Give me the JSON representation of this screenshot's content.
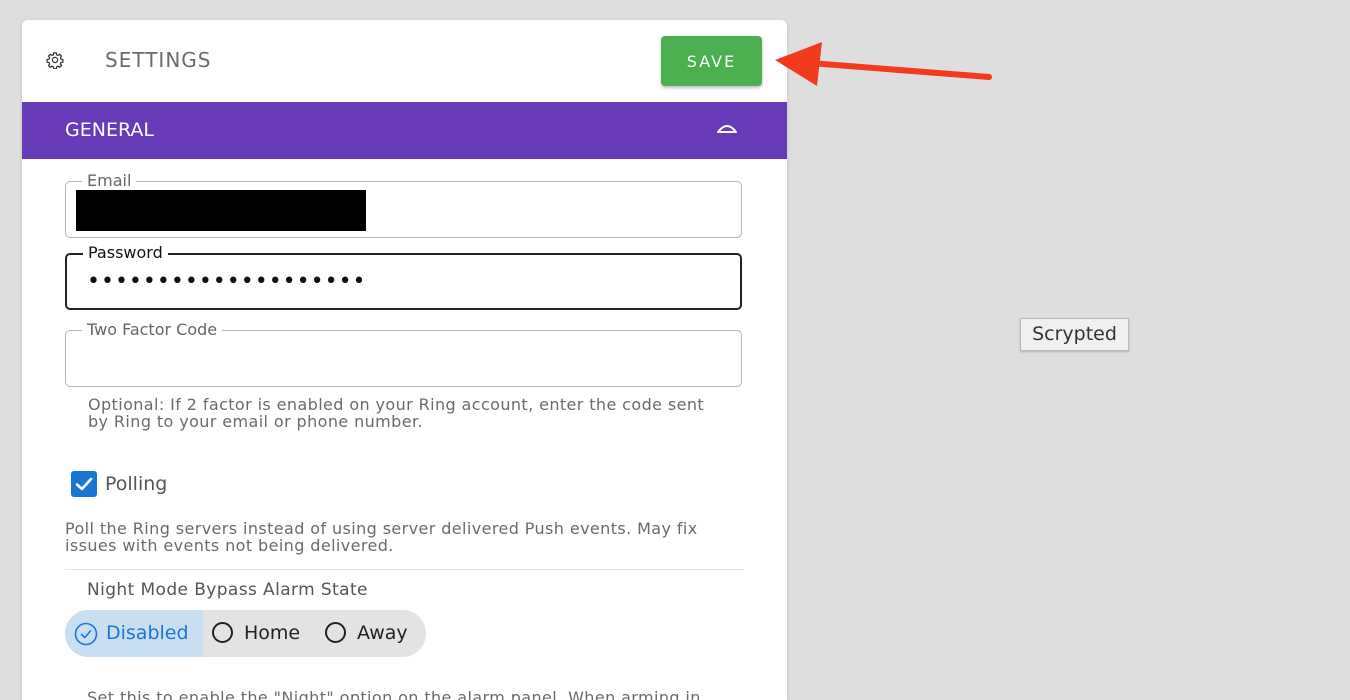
{
  "header": {
    "title": "SETTINGS",
    "save_label": "SAVE",
    "gear_icon": "gear-icon"
  },
  "section": {
    "title": "GENERAL",
    "chevron_icon": "chevron-up-icon",
    "color": "#673ab7"
  },
  "fields": {
    "email": {
      "label": "Email",
      "value": ""
    },
    "password": {
      "label": "Password",
      "value": "••••••••••••••••••••"
    },
    "two_factor": {
      "label": "Two Factor Code",
      "value": "",
      "hint_line1": "Optional: If 2 factor is enabled on your Ring account, enter the code sent",
      "hint_line2": "by Ring to your email or phone number."
    }
  },
  "polling": {
    "label": "Polling",
    "checked": true,
    "description_line1": "Poll the Ring servers instead of using server delivered Push events. May fix",
    "description_line2": "issues with events not being delivered."
  },
  "night_mode": {
    "title": "Night Mode Bypass Alarm State",
    "options": [
      "Disabled",
      "Home",
      "Away"
    ],
    "selected": "Disabled",
    "description_partial": "Set this to enable the \"Night\" option on the alarm panel. When arming in"
  },
  "tooltip": {
    "text": "Scrypted"
  },
  "colors": {
    "save_button": "#4caf50",
    "annotation_arrow": "#f23a1d",
    "checkbox": "#1976d2"
  }
}
